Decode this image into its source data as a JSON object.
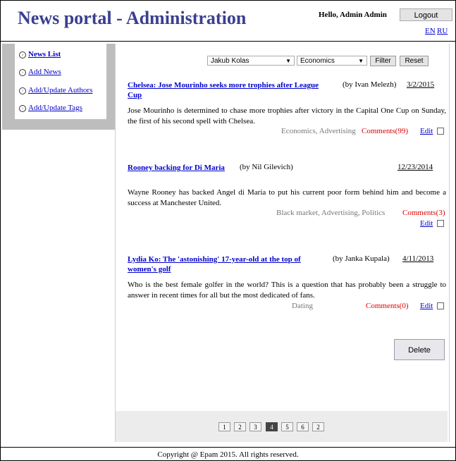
{
  "header": {
    "title": "News portal - Administration",
    "greeting": "Hello, Admin Admin",
    "logout_label": "Logout",
    "lang_en": "EN",
    "lang_ru": "RU"
  },
  "sidebar": {
    "items": [
      {
        "label": "News List",
        "active": true
      },
      {
        "label": "Add News"
      },
      {
        "label": "Add/Update Authors"
      },
      {
        "label": "Add/Update Tags"
      }
    ]
  },
  "filter": {
    "author_value": "Jakub Kolas",
    "tag_value": "Economics",
    "filter_label": "Filter",
    "reset_label": "Reset"
  },
  "news": [
    {
      "title": "Chelsea: Jose Mourinho seeks more trophies after League Cup",
      "author": "(by Ivan Melezh)",
      "date": "3/2/2015",
      "brief": "Jose Mourinho is determined to chase more trophies after victory in the Capital One Cup on Sunday, the first of his second spell with Chelsea.",
      "tags": "Economics, Advertising",
      "comments": "Comments(99)",
      "edit": "Edit"
    },
    {
      "title": "Rooney backing for Di Maria",
      "author": "(by Nil Gilevich)",
      "date": "12/23/2014",
      "brief": "Wayne Rooney has backed Angel di Maria to put his current poor form behind him and become a success at Manchester United.",
      "tags": "Black market, Advertising, Politics",
      "comments": "Comments(3)",
      "edit": "Edit"
    },
    {
      "title": "Lydia Ko: The 'astonishing' 17-year-old at the top of women's golf",
      "author": "(by Janka Kupala)",
      "date": "4/11/2013",
      "brief": "Who is the best female golfer in the world? This is a question that has probably been a struggle to answer in recent times for all but the most dedicated of fans.",
      "tags": "Dating",
      "comments": "Comments(0)",
      "edit": "Edit"
    }
  ],
  "delete_label": "Delete",
  "pagination": {
    "pages": [
      "1",
      "2",
      "3",
      "4",
      "5",
      "6",
      "2"
    ],
    "active_index": 3
  },
  "footer": {
    "copyright": "Copyright @ Epam 2015. All rights reserved."
  }
}
